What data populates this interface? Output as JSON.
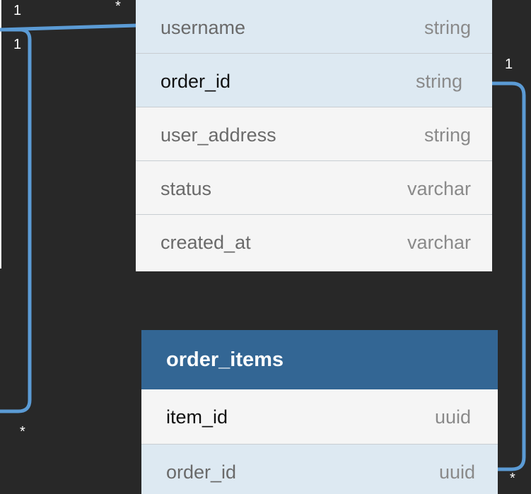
{
  "orders_table": {
    "fields": [
      {
        "name": "username",
        "type": "string",
        "highlight": true,
        "emphasis": false
      },
      {
        "name": "order_id",
        "type": "string",
        "highlight": true,
        "emphasis": true
      },
      {
        "name": "user_address",
        "type": "string",
        "highlight": false,
        "emphasis": false
      },
      {
        "name": "status",
        "type": "varchar",
        "highlight": false,
        "emphasis": false
      },
      {
        "name": "created_at",
        "type": "varchar",
        "highlight": false,
        "emphasis": false
      }
    ]
  },
  "order_items_table": {
    "title": "order_items",
    "fields": [
      {
        "name": "item_id",
        "type": "uuid",
        "highlight": false,
        "emphasis": true
      },
      {
        "name": "order_id",
        "type": "uuid",
        "highlight": true,
        "emphasis": false
      }
    ]
  },
  "relations": {
    "users_orders": {
      "source_label": "1",
      "target_label": "*"
    },
    "left_loop": {
      "source_label": "1",
      "target_label": "*"
    },
    "orders_items": {
      "source_label": "1",
      "target_label": "*"
    }
  },
  "colors": {
    "background": "#282828",
    "connector": "#5b9bd5",
    "header": "#336694",
    "highlight_row": "#dde9f2",
    "plain_row": "#f5f5f5"
  }
}
